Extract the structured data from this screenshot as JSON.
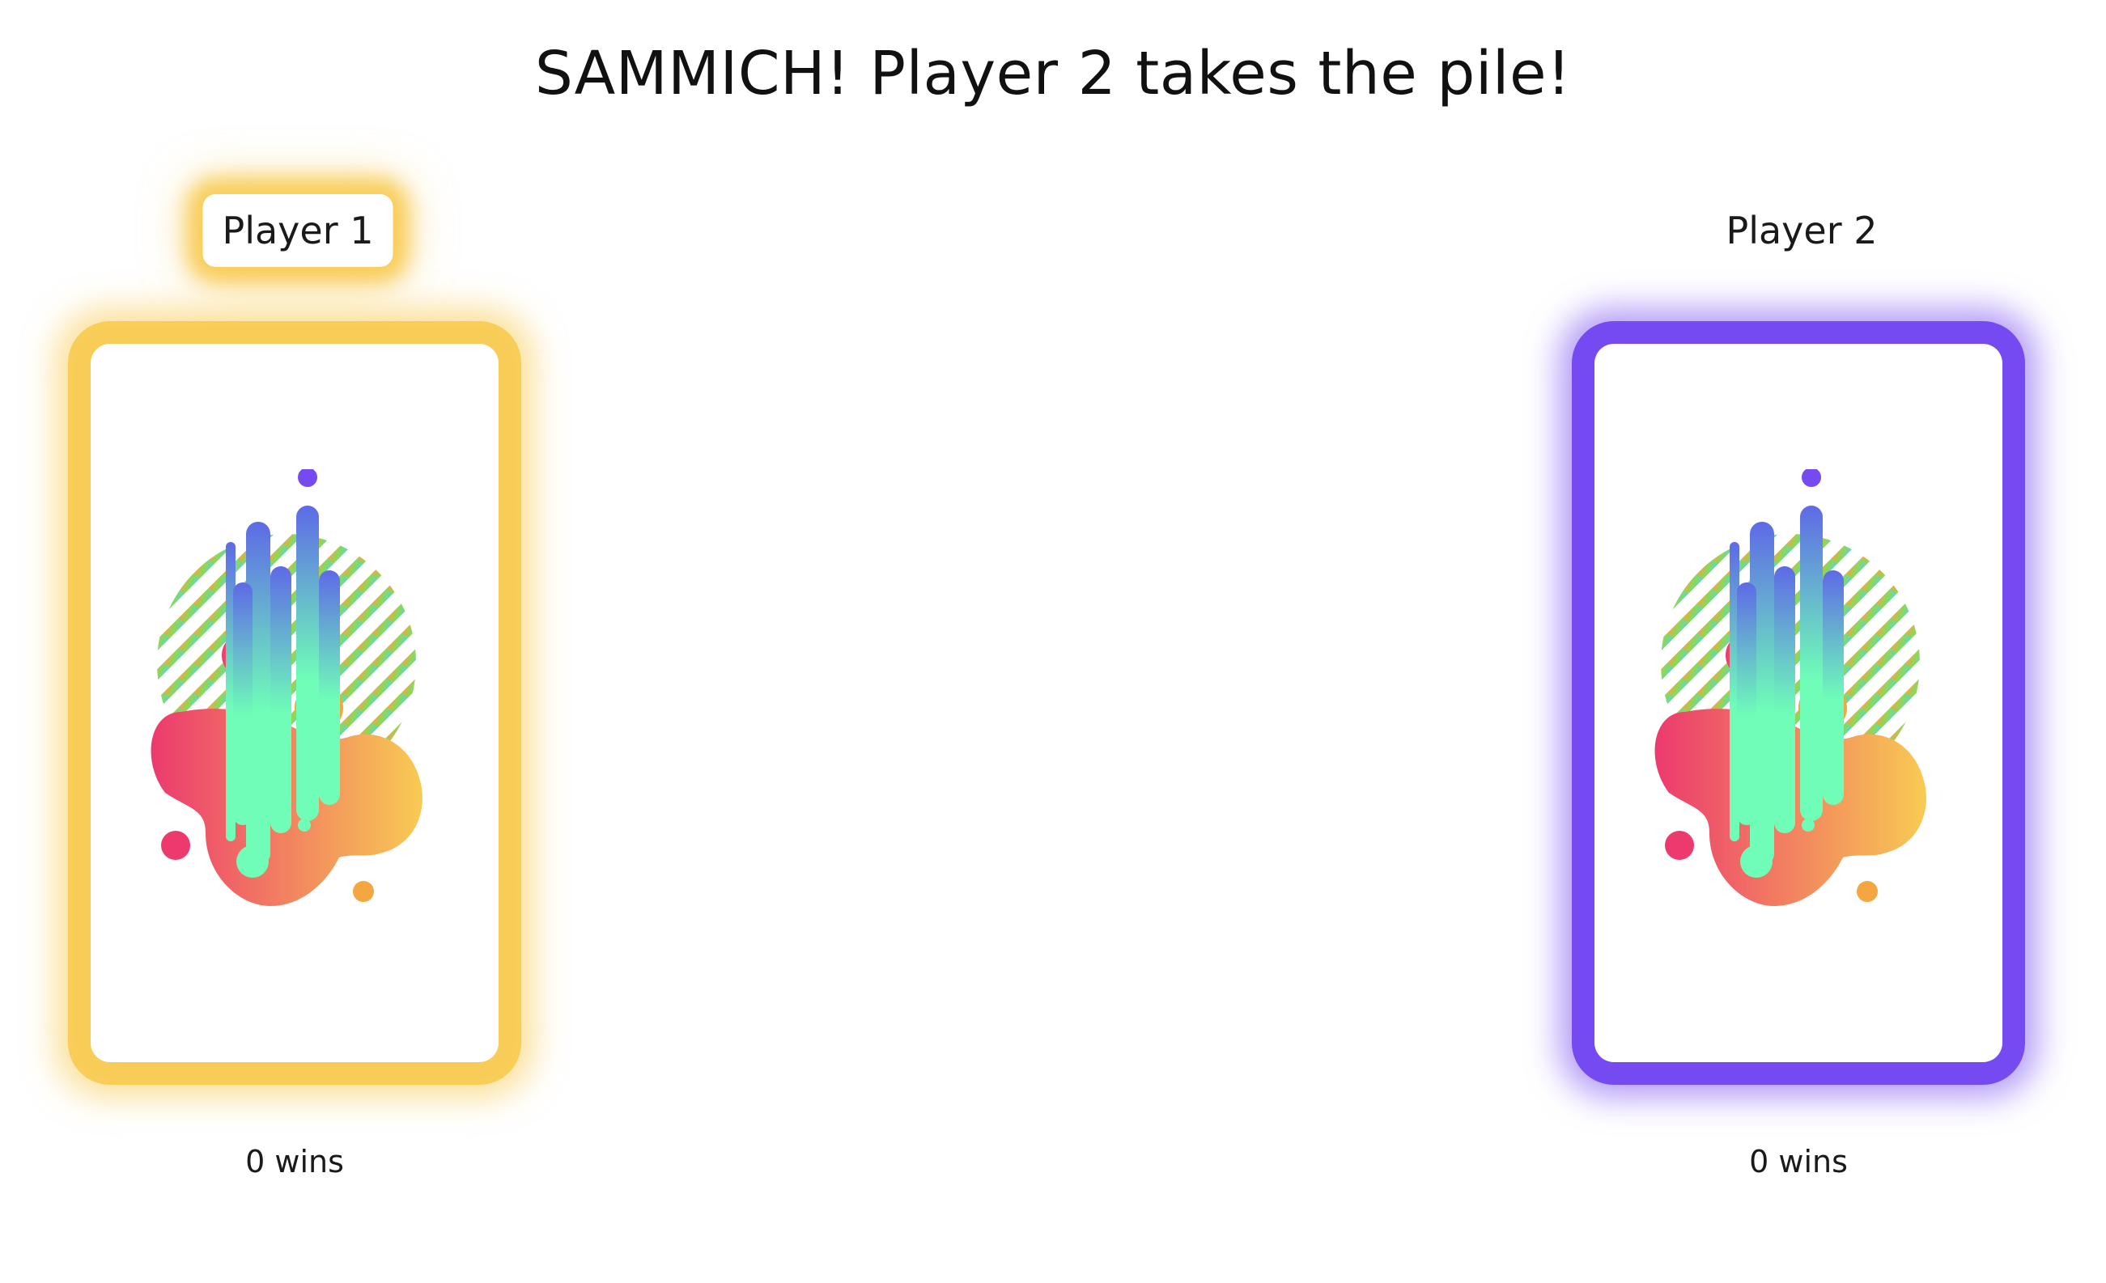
{
  "status_message": "SAMMICH! Player 2 takes the pile!",
  "players": [
    {
      "name": "Player 1",
      "wins_label": "0 wins",
      "active_turn": true,
      "card_glow_color": "#F8CB53",
      "card_art": "abstract-splash-card-back"
    },
    {
      "name": "Player 2",
      "wins_label": "0 wins",
      "active_turn": false,
      "card_glow_color": "#764AF1",
      "card_art": "abstract-splash-card-back"
    }
  ],
  "colors": {
    "accent_yellow": "#F8CB53",
    "accent_purple": "#764AF1",
    "splash_pink": "#EC3A6E",
    "splash_orange": "#F8CB53",
    "drip_mint": "#6FFDB8",
    "drip_blue": "#5E6AE6"
  }
}
